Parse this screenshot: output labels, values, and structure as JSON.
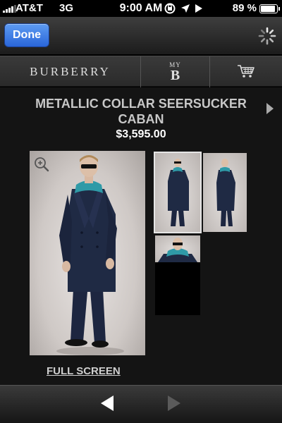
{
  "status_bar": {
    "carrier": "AT&T",
    "network": "3G",
    "time": "9:00 AM",
    "battery_percent": "89 %",
    "battery_level": 0.89,
    "icons": [
      "orientation-lock-icon",
      "location-arrow-icon",
      "play-icon"
    ]
  },
  "toolbar": {
    "done_label": "Done",
    "loading_icon": "spinner-icon"
  },
  "nav": {
    "brand": "BURBERRY",
    "my_label": "MY",
    "b_label": "B",
    "cart_icon": "shopping-cart-icon"
  },
  "product": {
    "title": "METALLIC COLLAR SEERSUCKER CABAN",
    "price": "$3,595.00",
    "full_screen_label": "FULL SCREEN",
    "zoom_icon": "zoom-in-icon",
    "thumbnails": [
      "front-view",
      "side-view",
      "collar-detail"
    ],
    "selected_thumbnail": 0
  },
  "bottom_nav": {
    "prev_icon": "triangle-left-icon",
    "next_icon": "triangle-right-icon"
  },
  "colors": {
    "done_button": "#2f6fe0",
    "coat": "#1f2a44",
    "collar": "#2f9aa7"
  }
}
